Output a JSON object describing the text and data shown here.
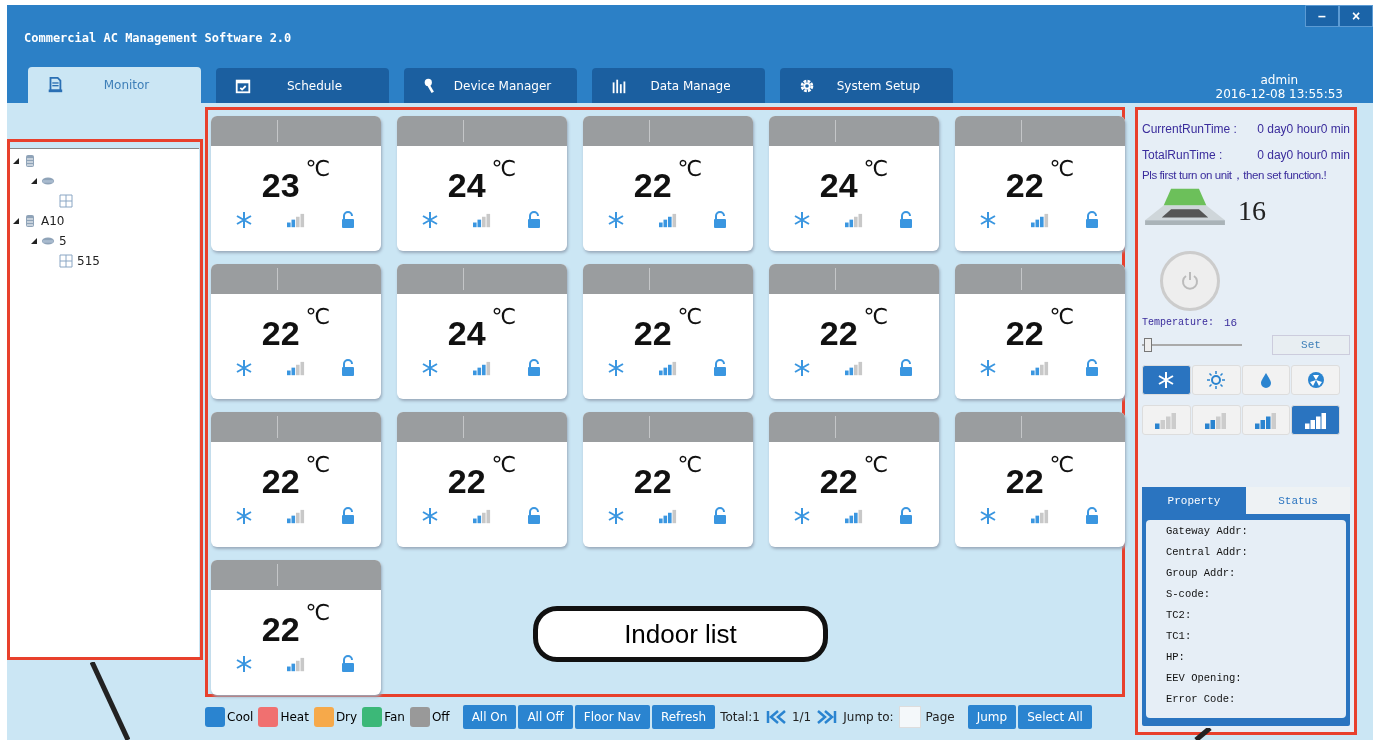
{
  "window": {
    "title": "Commercial AC Management Software 2.0",
    "controls": [
      "–",
      "×"
    ]
  },
  "tabs": [
    {
      "label": "Monitor",
      "kind": "doc",
      "selected": true
    },
    {
      "label": "Schedule",
      "kind": "calendar",
      "selected": false
    },
    {
      "label": "Device Manager",
      "kind": "wrench",
      "selected": false
    },
    {
      "label": "Data Manage",
      "kind": "bars",
      "selected": false
    },
    {
      "label": "System Setup",
      "kind": "gear",
      "selected": false
    }
  ],
  "user": {
    "name": "admin",
    "datetime": "2016-12-08 13:55:53"
  },
  "tree": [
    {
      "kind": "building",
      "expanded": true,
      "children": [
        {
          "kind": "floor",
          "expanded": true,
          "children": [
            {
              "kind": "room"
            }
          ]
        }
      ]
    },
    {
      "kind": "building",
      "label": "A10",
      "expanded": true,
      "children": [
        {
          "kind": "floor",
          "label": "5",
          "expanded": true,
          "children": [
            {
              "kind": "room",
              "label": "515"
            }
          ]
        }
      ]
    }
  ],
  "indoor_units": [
    {
      "temp": "23",
      "unit": "℃",
      "level": 0.5
    },
    {
      "temp": "24",
      "unit": "℃",
      "level": 0.5
    },
    {
      "temp": "22",
      "unit": "℃",
      "level": 0.75
    },
    {
      "temp": "24",
      "unit": "℃",
      "level": 0.5
    },
    {
      "temp": "22",
      "unit": "℃",
      "level": 0.75
    },
    {
      "temp": "22",
      "unit": "℃",
      "level": 0.5
    },
    {
      "temp": "24",
      "unit": "℃",
      "level": 0.75
    },
    {
      "temp": "22",
      "unit": "℃",
      "level": 0.75
    },
    {
      "temp": "22",
      "unit": "℃",
      "level": 0.5
    },
    {
      "temp": "22",
      "unit": "℃",
      "level": 0.5
    },
    {
      "temp": "22",
      "unit": "℃",
      "level": 0.5
    },
    {
      "temp": "22",
      "unit": "℃",
      "level": 0.5
    },
    {
      "temp": "22",
      "unit": "℃",
      "level": 0.75
    },
    {
      "temp": "22",
      "unit": "℃",
      "level": 0.75
    },
    {
      "temp": "22",
      "unit": "℃",
      "level": 0.5
    },
    {
      "temp": "22",
      "unit": "℃",
      "level": 0.5
    }
  ],
  "annotation": "Indoor list",
  "legend": [
    {
      "label": "Cool",
      "color": "#2a84d0"
    },
    {
      "label": "Heat",
      "color": "#f07070"
    },
    {
      "label": "Dry",
      "color": "#f6a94a"
    },
    {
      "label": "Fan",
      "color": "#3cb878"
    },
    {
      "label": "Off",
      "color": "#999999"
    }
  ],
  "actions": [
    "All On",
    "All Off",
    "Floor Nav",
    "Refresh"
  ],
  "total": "Total:1",
  "page": "1/1",
  "jump_label": "Jump to:",
  "page_label": "Page",
  "page_actions": [
    "Jump",
    "Select All"
  ],
  "panel": {
    "current_label": "CurrentRunTime :",
    "current_value": "0 day0 hour0 min",
    "total_label": "TotalRunTime :",
    "total_value": "0 day0 hour0 min",
    "hint": "Pls first turn on unit，then set function.!",
    "set_temp": "16",
    "temp_label": "Temperature:",
    "temp_value": "16",
    "level": 0.02,
    "set_button": "Set",
    "modes": [
      {
        "kind": "cool",
        "selected": true
      },
      {
        "kind": "heat",
        "selected": false
      },
      {
        "kind": "dry",
        "selected": false
      },
      {
        "kind": "fan",
        "selected": false
      }
    ],
    "speeds": [
      {
        "kind": "low",
        "selected": false
      },
      {
        "kind": "medium",
        "selected": false
      },
      {
        "kind": "high",
        "selected": false
      },
      {
        "kind": "max",
        "selected": true
      }
    ],
    "info_tabs": [
      {
        "label": "Property",
        "selected": true
      },
      {
        "label": "Status",
        "selected": false
      }
    ],
    "properties": [
      "Gateway Addr:",
      "Central Addr:",
      "Group Addr:",
      "S-code:",
      "TC2:",
      "TC1:",
      "HP:",
      "EEV Opening:",
      "Error Code:"
    ]
  }
}
